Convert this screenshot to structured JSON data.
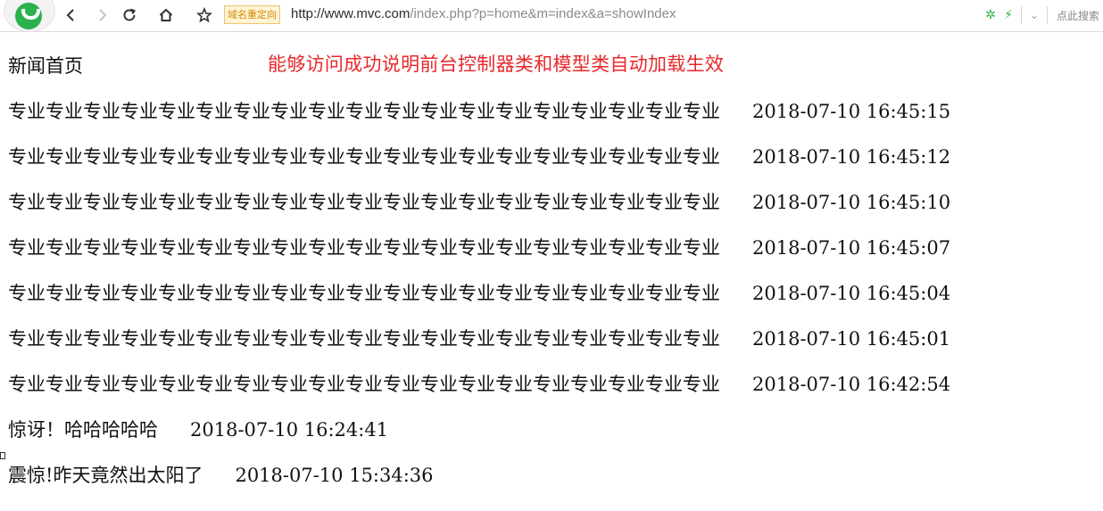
{
  "browser": {
    "redirect_badge": "域名重定向",
    "url_host": "http://www.mvc.com",
    "url_path": "/index.php?p=home&m=index&a=showIndex",
    "search_hint": "点此搜索"
  },
  "page": {
    "title": "新闻首页",
    "annotation": "能够访问成功说明前台控制器类和模型类自动加载生效"
  },
  "news": [
    {
      "title": "专业专业专业专业专业专业专业专业专业专业专业专业专业专业专业专业专业专业专业",
      "time": "2018-07-10 16:45:15"
    },
    {
      "title": "专业专业专业专业专业专业专业专业专业专业专业专业专业专业专业专业专业专业专业",
      "time": "2018-07-10 16:45:12"
    },
    {
      "title": "专业专业专业专业专业专业专业专业专业专业专业专业专业专业专业专业专业专业专业",
      "time": "2018-07-10 16:45:10"
    },
    {
      "title": "专业专业专业专业专业专业专业专业专业专业专业专业专业专业专业专业专业专业专业",
      "time": "2018-07-10 16:45:07"
    },
    {
      "title": "专业专业专业专业专业专业专业专业专业专业专业专业专业专业专业专业专业专业专业",
      "time": "2018-07-10 16:45:04"
    },
    {
      "title": "专业专业专业专业专业专业专业专业专业专业专业专业专业专业专业专业专业专业专业",
      "time": "2018-07-10 16:45:01"
    },
    {
      "title": "专业专业专业专业专业专业专业专业专业专业专业专业专业专业专业专业专业专业专业",
      "time": "2018-07-10 16:42:54"
    },
    {
      "title": "惊讶！哈哈哈哈哈",
      "time": "2018-07-10 16:24:41"
    },
    {
      "title": "震惊!昨天竟然出太阳了",
      "time": "2018-07-10 15:34:36"
    }
  ],
  "colors": {
    "annotation": "#e8282b",
    "brand": "#2bb24c",
    "badge_bg": "#fff4d6",
    "badge_text": "#d68a00"
  },
  "icons": {
    "back": "arrow-left-icon",
    "forward": "arrow-right-icon",
    "reload": "reload-icon",
    "home": "home-icon",
    "bookmark": "star-icon",
    "extension": "gear-icon",
    "speed": "lightning-icon",
    "menu": "chevron-down-icon"
  }
}
